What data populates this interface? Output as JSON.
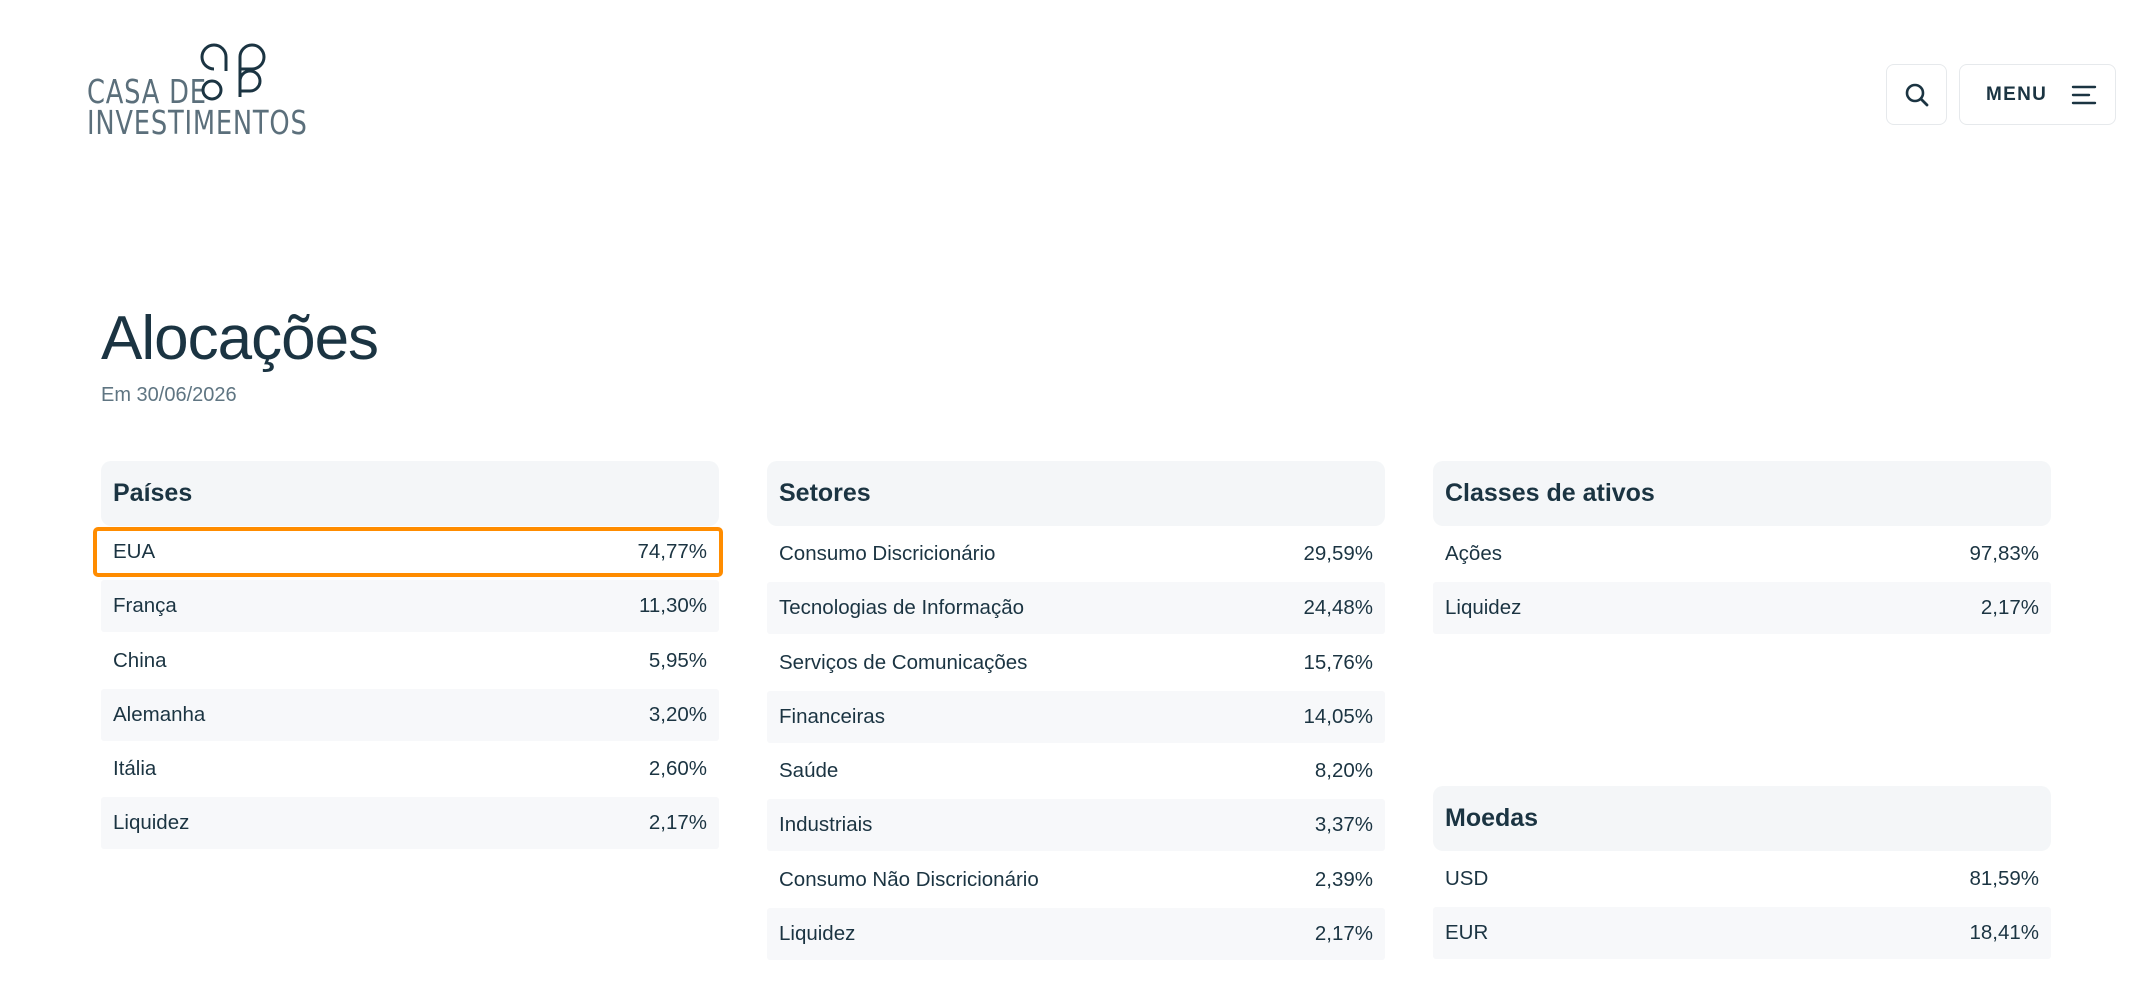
{
  "logo": {
    "line1": "CASA DE",
    "line2": "INVESTIMENTOS"
  },
  "header": {
    "menu_label": "MENU"
  },
  "icons": {
    "search": "search-icon",
    "menu": "hamburger-icon"
  },
  "colors": {
    "text": "#1b3442",
    "highlight": "#ff8c00",
    "header_bg": "#f4f6f8"
  },
  "page": {
    "title": "Alocações",
    "date": "Em 30/06/2026"
  },
  "paises": {
    "title": "Países",
    "rows": [
      {
        "label": "EUA",
        "value": "74,77%"
      },
      {
        "label": "França",
        "value": "11,30%"
      },
      {
        "label": "China",
        "value": "5,95%"
      },
      {
        "label": "Alemanha",
        "value": "3,20%"
      },
      {
        "label": "Itália",
        "value": "2,60%"
      },
      {
        "label": "Liquidez",
        "value": "2,17%"
      }
    ]
  },
  "setores": {
    "title": "Setores",
    "rows": [
      {
        "label": "Consumo Discricionário",
        "value": "29,59%"
      },
      {
        "label": "Tecnologias de Informação",
        "value": "24,48%"
      },
      {
        "label": "Serviços de Comunicações",
        "value": "15,76%"
      },
      {
        "label": "Financeiras",
        "value": "14,05%"
      },
      {
        "label": "Saúde",
        "value": "8,20%"
      },
      {
        "label": "Industriais",
        "value": "3,37%"
      },
      {
        "label": "Consumo Não Discricionário",
        "value": "2,39%"
      },
      {
        "label": "Liquidez",
        "value": "2,17%"
      }
    ]
  },
  "classes": {
    "title": "Classes de ativos",
    "rows": [
      {
        "label": "Ações",
        "value": "97,83%"
      },
      {
        "label": "Liquidez",
        "value": "2,17%"
      }
    ]
  },
  "moedas": {
    "title": "Moedas",
    "rows": [
      {
        "label": "USD",
        "value": "81,59%"
      },
      {
        "label": "EUR",
        "value": "18,41%"
      }
    ]
  }
}
